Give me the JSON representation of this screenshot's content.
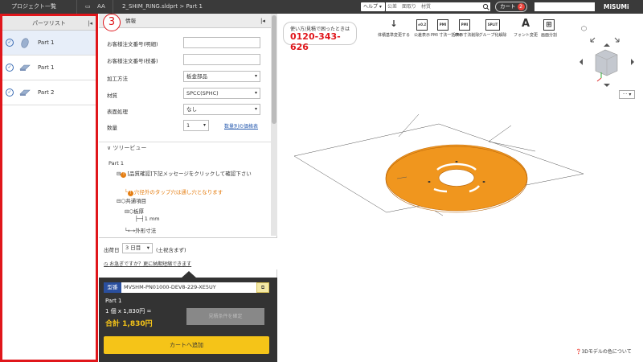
{
  "topbar": {
    "breadcrumb_project": "プロジェクト一覧",
    "breadcrumb_folder": "AA",
    "breadcrumb_file": "2_SHIM_RING.sldprt > Part 1",
    "help_label": "ヘルプ",
    "search_text": "公差　面取り　材質",
    "cart_label": "カート",
    "cart_count": "2",
    "logo": "MiSUMi"
  },
  "parts_panel": {
    "title": "パーツリスト",
    "collapse": "|◂",
    "items": [
      {
        "label": "Part 1",
        "selected": true
      },
      {
        "label": "Part 1",
        "selected": false
      },
      {
        "label": "Part 2",
        "selected": false
      }
    ]
  },
  "details_panel": {
    "step_badge": "3",
    "title": "情報",
    "collapse": "|◂",
    "fields": [
      {
        "label": "お客様注文番号(明細)",
        "value": ""
      },
      {
        "label": "お客様注文番号(枝番)",
        "value": ""
      },
      {
        "label": "加工方法",
        "value": "板金部品"
      },
      {
        "label": "材質",
        "value": "SPCC(SPHC)"
      },
      {
        "label": "表面処理",
        "value": "なし"
      }
    ],
    "quantity_label": "数量",
    "quantity_value": "1",
    "price_table_link": "数量別の価格表"
  },
  "tree": {
    "header": "ツリービュー",
    "root": "Part 1",
    "warning1": "[品質確認]下記メッセージをクリックして確認下さい",
    "warning2": "穴径",
    "warning3": "外のタップ穴は通し穴となります",
    "common": "共通項目",
    "thickness": "板厚",
    "thickness_value": "1 mm",
    "outer": "外形寸法"
  },
  "shipping": {
    "label": "出荷日",
    "days": "3 日目",
    "note": "(土祝含まず)",
    "hurry_link": "お急ぎですか？更に納期短縮できます"
  },
  "order": {
    "tag": "型番",
    "model_number": "MVSHM-PN01000-DEV8-229-XE5UY",
    "part_name": "Part 1",
    "unit_price": "1 個 x 1,830円 =",
    "total": "合計 1,830円",
    "confirm_button": "見積条件を確定",
    "add_to_cart": "カートへ追加"
  },
  "viewer": {
    "phone_caption": "使い方/見積で困ったときは",
    "phone_number": "0120-343-626",
    "tools": [
      {
        "label": "体積基準変更する",
        "icon": "↓"
      },
      {
        "label": "公差表示",
        "icon": "±0.2"
      },
      {
        "label": "PMI 寸法一括表示",
        "icon": "PMI"
      },
      {
        "label": "PMI 寸法削除",
        "icon": "PMI"
      },
      {
        "label": "グループ化解除",
        "icon": "SPLIT"
      },
      {
        "label": "フォント変更",
        "icon": "A"
      },
      {
        "label": "画面分割",
        "icon": "⊞"
      }
    ],
    "more": "···",
    "color_note": "3Dモデルの色について"
  },
  "colors": {
    "accent_red": "#e0161b",
    "part_orange": "#f0961e",
    "cart_yellow": "#f5c418"
  }
}
